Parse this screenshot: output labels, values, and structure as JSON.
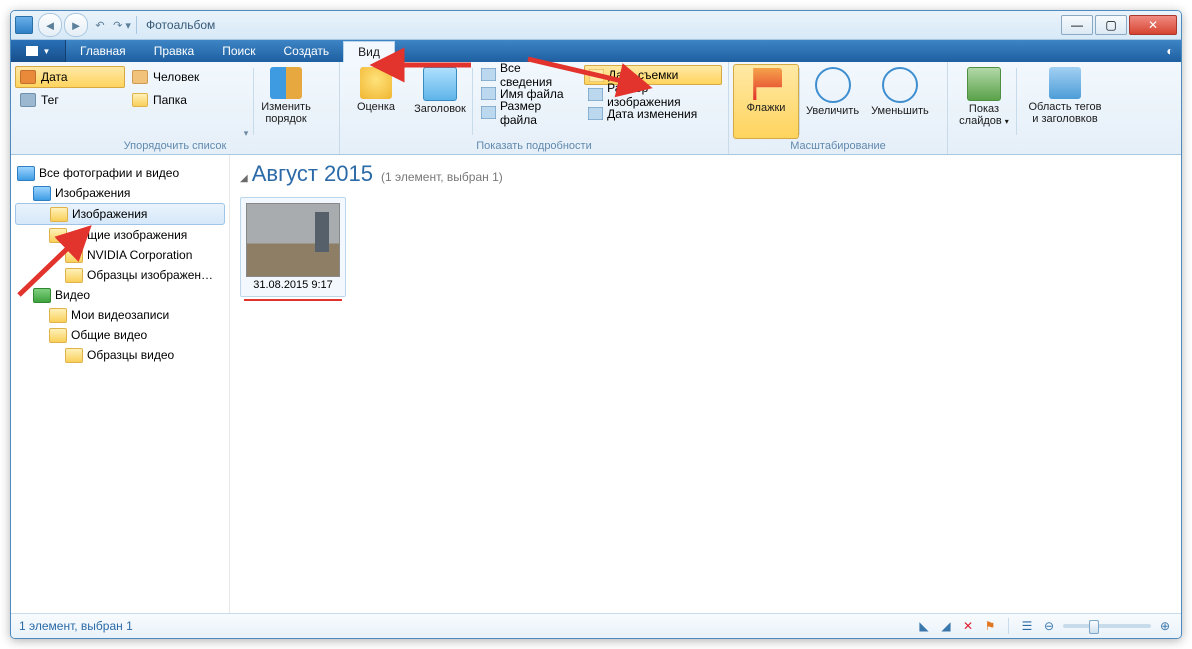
{
  "window": {
    "title": "Фотоальбом"
  },
  "menu": {
    "items": [
      "Главная",
      "Правка",
      "Поиск",
      "Создать",
      "Вид"
    ],
    "active": 4
  },
  "ribbon": {
    "group_sort": {
      "label": "Упорядочить список",
      "btn_date": "Дата",
      "btn_tag": "Тег",
      "btn_person": "Человек",
      "btn_folder": "Папка",
      "btn_reorder": "Изменить\nпорядок"
    },
    "group_details": {
      "label": "Показать подробности",
      "btn_rating": "Оценка",
      "btn_title": "Заголовок",
      "chk_all": "Все сведения",
      "chk_filename": "Имя файла",
      "chk_filesize": "Размер файла",
      "chk_datetaken": "Дата съемки",
      "chk_imgsize": "Размер изображения",
      "chk_modified": "Дата изменения"
    },
    "group_zoom": {
      "label": "Масштабирование",
      "btn_flags": "Флажки",
      "btn_zoomin": "Увеличить",
      "btn_zoomout": "Уменьшить"
    },
    "btn_slideshow": "Показ\nслайдов",
    "btn_tagarea": "Область тегов\nи заголовков"
  },
  "tree": {
    "root": "Все фотографии и видео",
    "images": "Изображения",
    "images_sub": "Изображения",
    "shared_images": "Общие изображения",
    "nvidia": "NVIDIA Corporation",
    "sample_images": "Образцы изображен…",
    "video": "Видео",
    "my_videos": "Мои видеозаписи",
    "shared_videos": "Общие видео",
    "sample_videos": "Образцы видео"
  },
  "content": {
    "group_title": "Август 2015",
    "group_sub": "(1 элемент, выбран 1)",
    "thumb_caption": "31.08.2015 9:17"
  },
  "status": {
    "text": "1 элемент, выбран 1"
  }
}
